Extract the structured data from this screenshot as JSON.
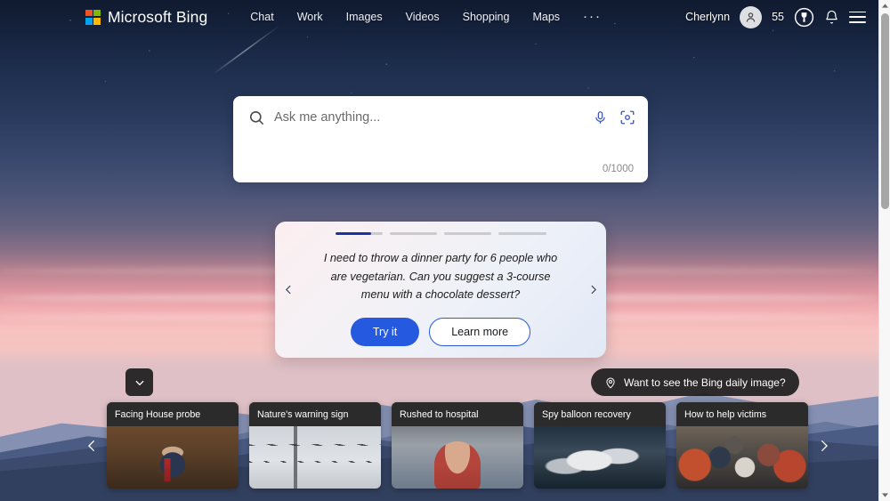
{
  "header": {
    "brand_name": "Microsoft Bing",
    "logo_colors": [
      "#f25022",
      "#7fba00",
      "#00a4ef",
      "#ffb900"
    ],
    "nav": [
      {
        "label": "Chat",
        "name": "chat"
      },
      {
        "label": "Work",
        "name": "work"
      },
      {
        "label": "Images",
        "name": "images"
      },
      {
        "label": "Videos",
        "name": "videos"
      },
      {
        "label": "Shopping",
        "name": "shopping"
      },
      {
        "label": "Maps",
        "name": "maps"
      }
    ],
    "more_label": "···",
    "user_name": "Cherlynn",
    "rewards_points": "55",
    "icons": {
      "avatar": "person-icon",
      "rewards": "trophy-icon",
      "notifications": "bell-icon",
      "menu": "hamburger-icon"
    }
  },
  "search": {
    "placeholder": "Ask me anything...",
    "value": "",
    "counter": "0/1000",
    "icons": {
      "search": "search-icon",
      "mic": "microphone-icon",
      "visual": "visual-search-icon"
    }
  },
  "suggestion_card": {
    "progress": {
      "total": 4,
      "active_index": 0,
      "active_fill_pct": 76
    },
    "text": "I need to throw a dinner party for 6 people who are vegetarian. Can you suggest a 3-course menu with a chocolate dessert?",
    "primary_button": "Try it",
    "secondary_button": "Learn more",
    "prev_icon": "chevron-left-icon",
    "next_icon": "chevron-right-icon",
    "accent_color": "#2559e0",
    "progress_active_color": "#1a34a8"
  },
  "daily_image_pill": {
    "label": "Want to see the Bing daily image?",
    "icon": "location-pin-icon"
  },
  "expand_button": {
    "icon": "chevron-down-icon"
  },
  "carousel": {
    "prev_icon": "chevron-left-icon",
    "next_icon": "chevron-right-icon",
    "cards": [
      {
        "title": "Facing House probe",
        "photo": "ph-congress"
      },
      {
        "title": "Nature's warning sign",
        "photo": "ph-wires"
      },
      {
        "title": "Rushed to hospital",
        "photo": "ph-fan"
      },
      {
        "title": "Spy balloon recovery",
        "photo": "ph-balloon"
      },
      {
        "title": "How to help victims",
        "photo": "ph-crowd"
      }
    ]
  },
  "scrollbar": {
    "up_icon": "triangle-up-icon",
    "down_icon": "triangle-down-icon",
    "thumb": "scrollbar-thumb"
  }
}
